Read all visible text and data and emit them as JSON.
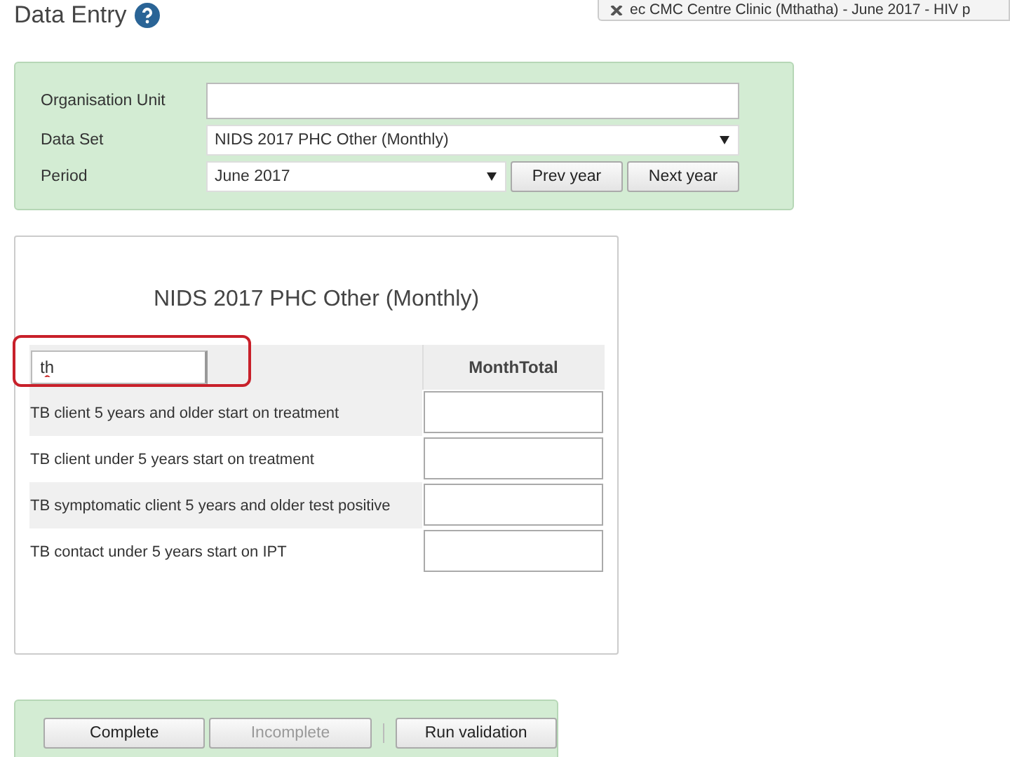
{
  "header": {
    "title": "Data Entry"
  },
  "context_bar": {
    "text": "ec CMC Centre Clinic (Mthatha) - June 2017 - HIV p"
  },
  "selection": {
    "fields": [
      {
        "label": "Organisation Unit",
        "kind": "text"
      },
      {
        "label": "Data Set",
        "kind": "select",
        "value": "NIDS 2017 PHC Other (Monthly)"
      },
      {
        "label": "Period",
        "kind": "period",
        "value": "June 2017",
        "buttons": [
          "Prev year",
          "Next year"
        ]
      }
    ]
  },
  "form": {
    "title": "NIDS 2017 PHC Other (Monthly)",
    "filter": {
      "value": "th",
      "highlighted": true
    },
    "column": "MonthTotal",
    "rows": [
      {
        "label": "TB client 5 years and older start on treatment"
      },
      {
        "label": "TB client under 5 years start on treatment"
      },
      {
        "label": "TB symptomatic client 5 years and older test positive"
      },
      {
        "label": "TB contact under 5 years start on IPT"
      }
    ]
  },
  "actions": [
    {
      "label": "Complete",
      "disabled": false
    },
    {
      "label": "Incomplete",
      "disabled": true
    },
    {
      "label": "Run validation",
      "disabled": false,
      "separated": true
    }
  ]
}
